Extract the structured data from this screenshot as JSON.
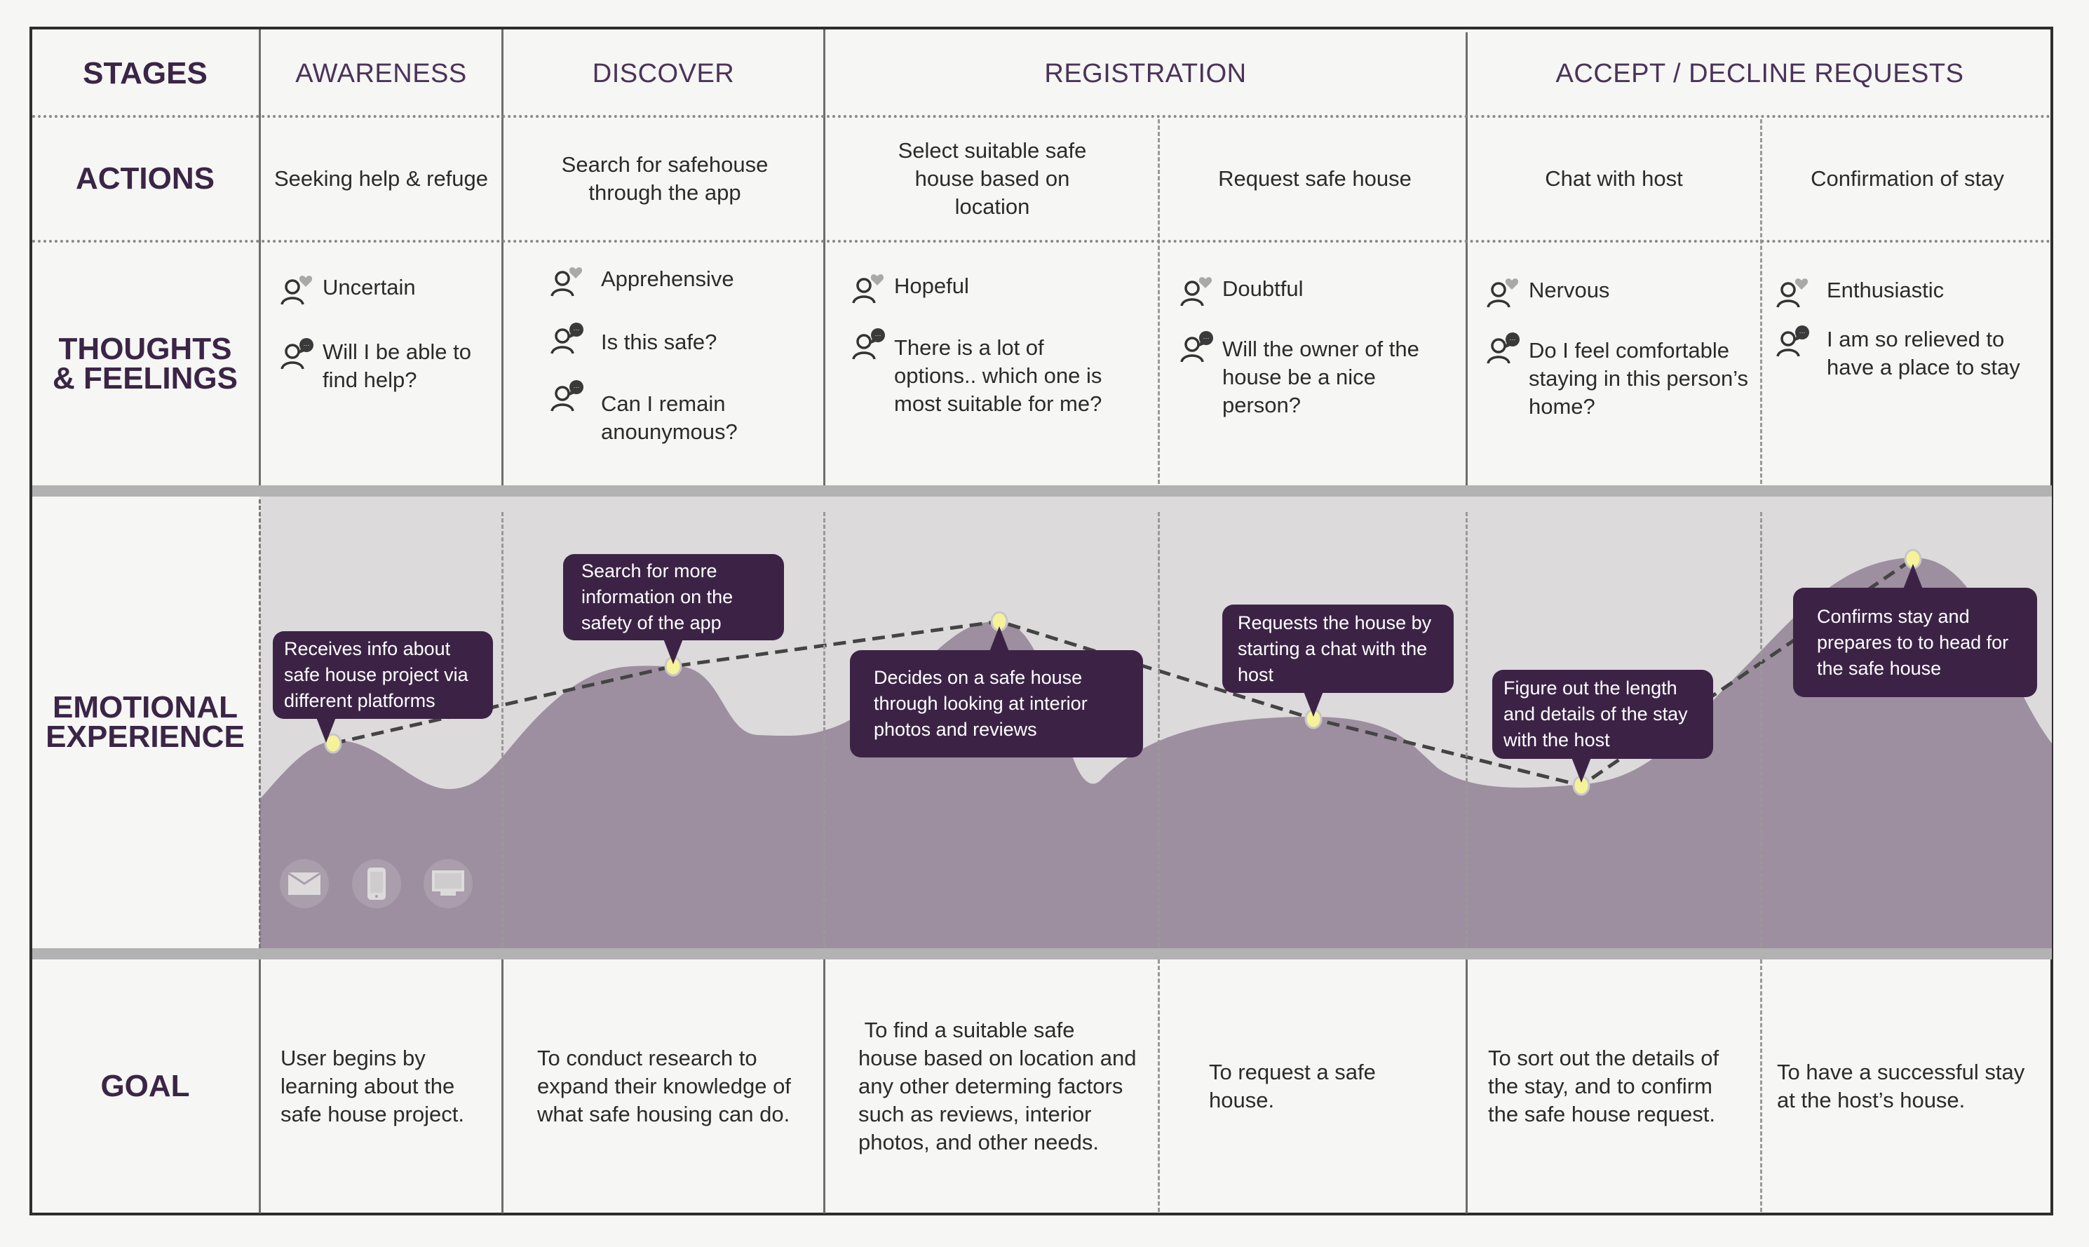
{
  "row_headers": {
    "stages": "STAGES",
    "actions": "ACTIONS",
    "thoughts_line1": "THOUGHTS",
    "thoughts_line2": "& FEELINGS",
    "emotional_line1": "EMOTIONAL",
    "emotional_line2": "EXPERIENCE",
    "goal": "GOAL"
  },
  "stages": [
    {
      "label": "AWARENESS"
    },
    {
      "label": "DISCOVER"
    },
    {
      "label": "REGISTRATION"
    },
    {
      "label": "ACCEPT / DECLINE REQUESTS"
    }
  ],
  "actions": [
    "Seeking help & refuge",
    "Search for safehouse through the app",
    "Select suitable safe house based  on location",
    "Request safe house",
    "Chat with host",
    "Confirmation of stay"
  ],
  "thoughts": [
    {
      "feeling": "Uncertain",
      "thoughts": [
        "Will I be able to find help?"
      ]
    },
    {
      "feeling": "Apprehensive",
      "thoughts": [
        "Is this safe?",
        "Can I remain anounymous?"
      ]
    },
    {
      "feeling": "Hopeful",
      "thoughts": [
        "There is a lot of options.. which one is most suitable for me?"
      ]
    },
    {
      "feeling": "Doubtful",
      "thoughts": [
        "Will the owner of the house be a nice person?"
      ]
    },
    {
      "feeling": "Nervous",
      "thoughts": [
        "Do I feel comfortable staying in this person’s home?"
      ]
    },
    {
      "feeling": "Enthusiastic",
      "thoughts": [
        "I am so relieved to have a place to stay"
      ]
    }
  ],
  "icons": {
    "feeling": "person-heart-icon",
    "thought": "person-speech-bubble-icon",
    "channels": [
      "mail-icon",
      "mobile-phone-icon",
      "monitor-icon"
    ]
  },
  "emotional_experience": {
    "callouts": [
      "Receives info about safe house project via different platforms",
      "Search for more information on the safety of the app",
      "Decides on a safe house through looking at interior photos and reviews",
      "Requests the house by starting a chat with the host",
      "Figure out the length and details of the stay with the host",
      "Confirms stay and prepares to to head for the safe house"
    ]
  },
  "goals": [
    "User begins by learning about the safe house project.",
    "To conduct research to expand their knowledge of what safe housing can do.",
    " To find a suitable safe house based on location and any other determing factors such as reviews, interior photos, and other needs.",
    "To request a safe house.",
    "To sort out the details of the stay, and to confirm the safe house request.",
    "To have a successful stay at the host’s house."
  ],
  "colors": {
    "heading": "#3b2546",
    "callout_bg": "#3c2346",
    "curve_fill": "#9d8f9f",
    "chart_bg": "#dcdadb",
    "point": "#f6f29a",
    "bar": "#b2b2b2"
  }
}
